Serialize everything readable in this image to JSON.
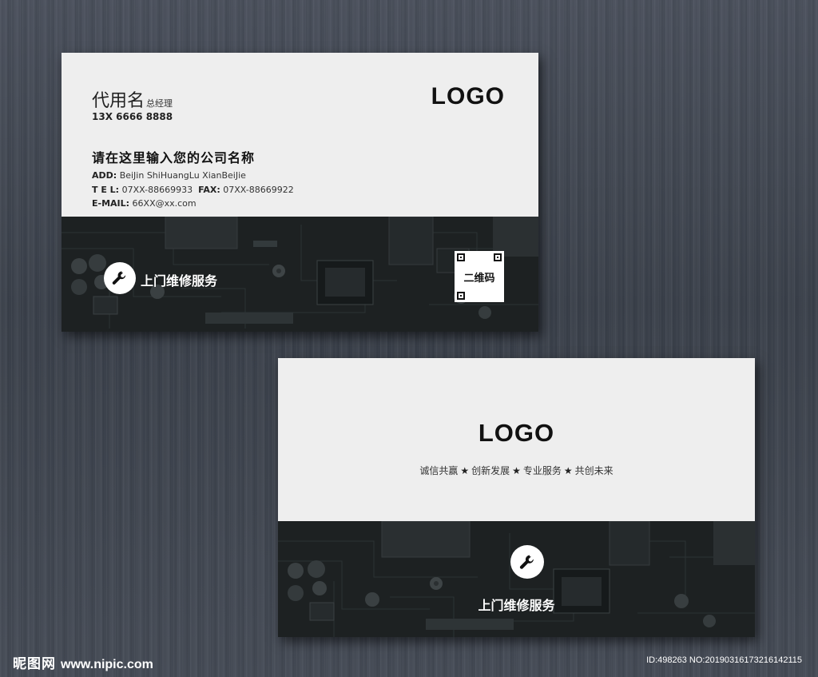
{
  "front_card": {
    "name": "代用名",
    "title": "总经理",
    "phone": "13X 6666 8888",
    "company": "请在这里输入您的公司名称",
    "address_label": "ADD:",
    "address": "BeiJin ShiHuangLu XianBeiJie",
    "tel_label": "T E L:",
    "tel": "07XX-88669933",
    "fax_label": "FAX:",
    "fax": "07XX-88669922",
    "email_label": "E-MAIL:",
    "email": "66XX@xx.com",
    "logo": "LOGO",
    "service_icon": "wrench-icon",
    "service": "上门维修服务",
    "qr_label": "二维码"
  },
  "back_card": {
    "logo": "LOGO",
    "slogan": [
      "诚信共赢",
      "创新发展",
      "专业服务",
      "共创未来"
    ],
    "slogan_separator": "★",
    "service_icon": "wrench-icon",
    "service": "上门维修服务"
  },
  "watermark": {
    "brand": "昵图网",
    "url": "www.nipic.com",
    "id_text": "ID:498263 NO:20190316173216142115"
  },
  "colors": {
    "card_bg": "#eeeeee",
    "pcb_bg": "#1f2324",
    "background": "#41474f",
    "text_dark": "#111111"
  }
}
